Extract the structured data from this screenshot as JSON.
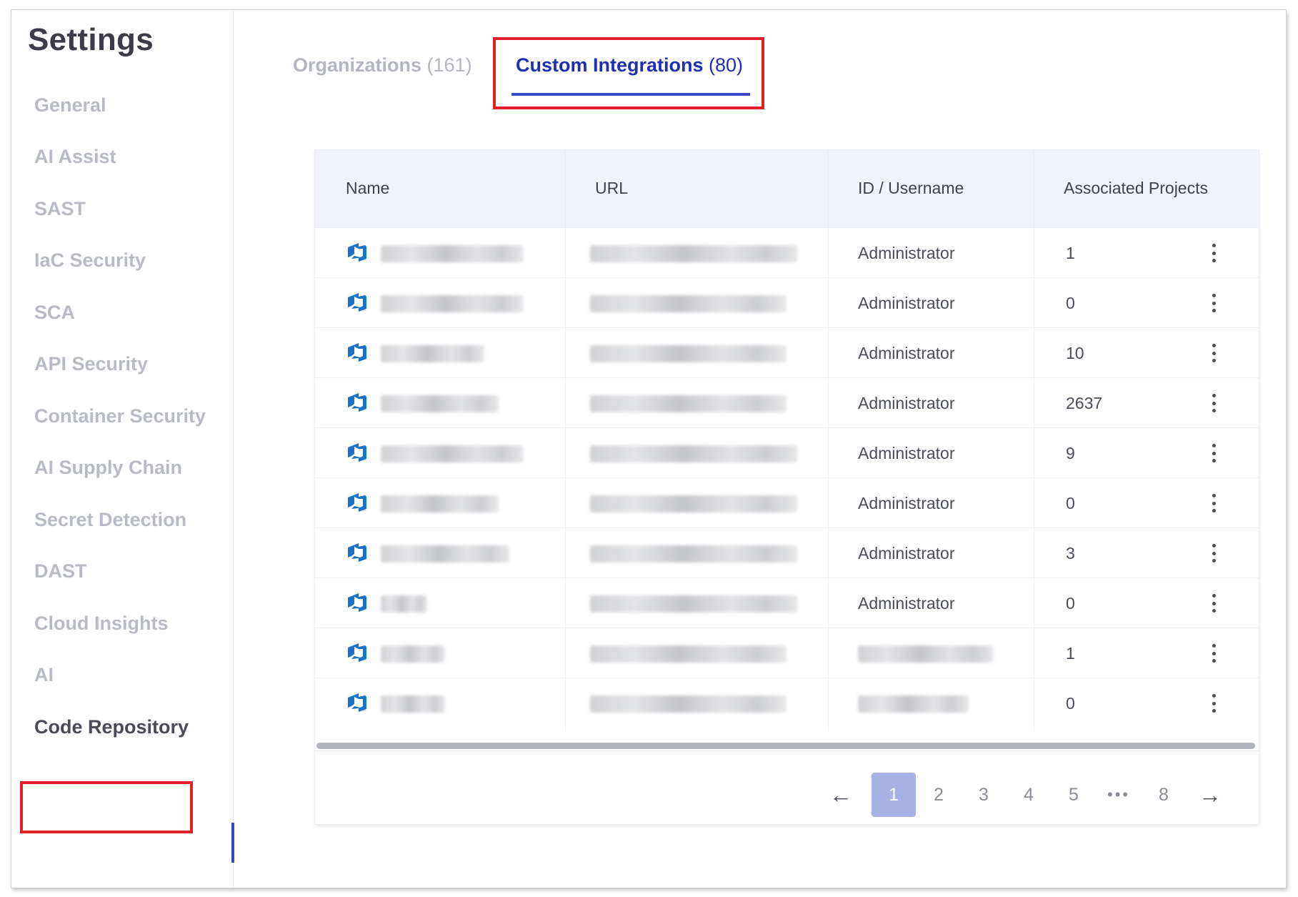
{
  "sidebar": {
    "title": "Settings",
    "items": [
      {
        "label": "General"
      },
      {
        "label": "AI Assist"
      },
      {
        "label": "SAST"
      },
      {
        "label": "IaC Security"
      },
      {
        "label": "SCA"
      },
      {
        "label": "API Security"
      },
      {
        "label": "Container Security"
      },
      {
        "label": "AI Supply Chain"
      },
      {
        "label": "Secret Detection"
      },
      {
        "label": "DAST"
      },
      {
        "label": "Cloud Insights"
      },
      {
        "label": "AI"
      },
      {
        "label": "Code Repository"
      }
    ],
    "active_item": "Code Repository"
  },
  "tabs": [
    {
      "label": "Organizations",
      "count": "(161)",
      "active": false
    },
    {
      "label": "Custom Integrations",
      "count": "(80)",
      "active": true
    }
  ],
  "table": {
    "columns": [
      "Name",
      "URL",
      "ID / Username",
      "Associated Projects"
    ],
    "rows": [
      {
        "name": "[redacted]",
        "url": "[redacted]",
        "id": "Administrator",
        "projects": "1"
      },
      {
        "name": "[redacted]",
        "url": "[redacted]",
        "id": "Administrator",
        "projects": "0"
      },
      {
        "name": "[redacted]",
        "url": "[redacted]",
        "id": "Administrator",
        "projects": "10"
      },
      {
        "name": "[redacted]",
        "url": "[redacted]",
        "id": "Administrator",
        "projects": "2637"
      },
      {
        "name": "[redacted]",
        "url": "[redacted]",
        "id": "Administrator",
        "projects": "9"
      },
      {
        "name": "[redacted]",
        "url": "[redacted]",
        "id": "Administrator",
        "projects": "0"
      },
      {
        "name": "[redacted]",
        "url": "[redacted]",
        "id": "Administrator",
        "projects": "3"
      },
      {
        "name": "[redacted]",
        "url": "[redacted]",
        "id": "Administrator",
        "projects": "0"
      },
      {
        "name": "[redacted]",
        "url": "[redacted]",
        "id": "[redacted]",
        "projects": "1"
      },
      {
        "name": "[redacted]",
        "url": "[redacted]",
        "id": "[redacted]",
        "projects": "0"
      }
    ],
    "row_icon": "azure-devops-icon",
    "row_action_icon": "kebab-menu-icon"
  },
  "pagination": {
    "prev_icon": "arrow-left-icon",
    "next_icon": "arrow-right-icon",
    "pages": [
      "1",
      "2",
      "3",
      "4",
      "5",
      "•••",
      "8"
    ],
    "current": "1"
  },
  "colors": {
    "accent": "#3848c4",
    "active_tab_text": "#1d2fb2",
    "highlight_annotation": "#e2202a",
    "azure_icon": "#1a73c8",
    "current_page_bg": "#a8b1e6"
  }
}
